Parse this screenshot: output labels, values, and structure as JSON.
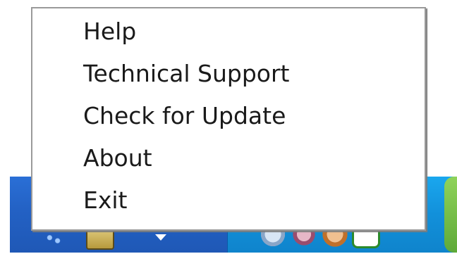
{
  "context_menu": {
    "items": [
      {
        "label": "Help"
      },
      {
        "label": "Technical Support"
      },
      {
        "label": "Check for Update"
      },
      {
        "label": "About"
      },
      {
        "label": "Exit"
      }
    ]
  },
  "taskbar": {
    "icons": [
      "quick-launch-icon",
      "hardware-icon",
      "show-hidden-icons-arrow",
      "network-tray-icon",
      "monitor-tray-icon",
      "volume-tray-icon",
      "app-tray-icon"
    ]
  },
  "colors": {
    "menu_background": "#ffffff",
    "menu_border": "#9a9a9a",
    "taskbar_blue": "#2361c4",
    "tray_blue": "#1290da"
  }
}
